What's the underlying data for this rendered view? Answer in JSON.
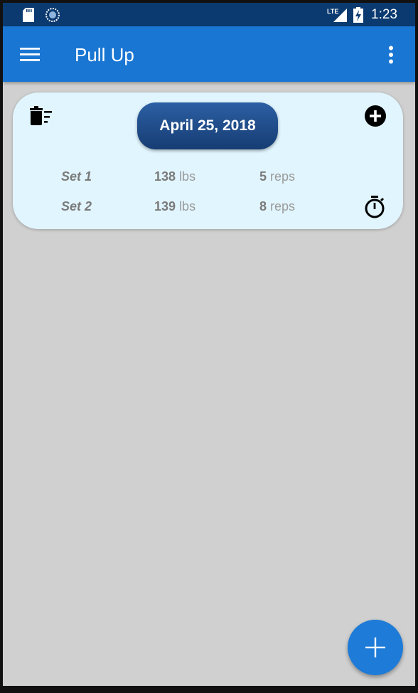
{
  "status_bar": {
    "time": "1:23",
    "network_label": "LTE",
    "icons": [
      "sd-card-icon",
      "sync-icon",
      "signal-icon",
      "battery-charging-icon"
    ]
  },
  "app_bar": {
    "title": "Pull Up",
    "icons": [
      "menu-icon",
      "more-vert-icon"
    ]
  },
  "workout_card": {
    "date": "April 25, 2018",
    "sets": [
      {
        "label": "Set 1",
        "weight": "138",
        "weight_unit": "lbs",
        "reps": "5",
        "reps_unit": "reps"
      },
      {
        "label": "Set 2",
        "weight": "139",
        "weight_unit": "lbs",
        "reps": "8",
        "reps_unit": "reps"
      }
    ],
    "icons": [
      "delete-sweep-icon",
      "add-circle-icon",
      "timer-icon"
    ]
  },
  "fab": {
    "icon": "plus-icon"
  },
  "colors": {
    "status_bar": "#0b3a70",
    "app_bar": "#1976d2",
    "background": "#d0d0d0",
    "card": "#e1f5fe",
    "date_button": "#1e4c8a",
    "fab": "#1e7bd8"
  }
}
